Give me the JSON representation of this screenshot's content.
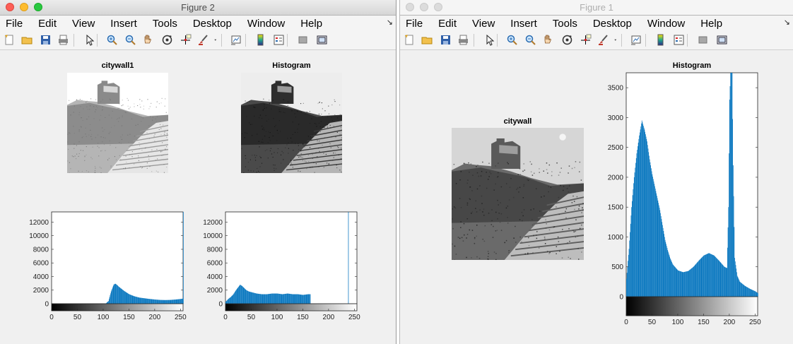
{
  "windows": [
    {
      "id": "figure2",
      "title": "Figure 2",
      "active": true,
      "menu": [
        "File",
        "Edit",
        "View",
        "Insert",
        "Tools",
        "Desktop",
        "Window",
        "Help"
      ],
      "images": [
        {
          "title": "citywall1",
          "style": "bright"
        },
        {
          "title": "Histogram",
          "style": "dark"
        }
      ],
      "histograms": [
        {
          "title": "",
          "style": "bright"
        },
        {
          "title": "",
          "style": "dark"
        }
      ]
    },
    {
      "id": "figure1",
      "title": "Figure 1",
      "active": false,
      "menu": [
        "File",
        "Edit",
        "View",
        "Insert",
        "Tools",
        "Desktop",
        "Window",
        "Help"
      ],
      "images": [
        {
          "title": "citywall",
          "style": "normal"
        }
      ],
      "histograms": [
        {
          "title": "Histogram",
          "style": "normal"
        }
      ]
    }
  ],
  "toolbar_icons": [
    "new-figure-icon",
    "open-file-icon",
    "save-icon",
    "print-icon",
    "pointer-icon",
    "zoom-in-icon",
    "zoom-out-icon",
    "pan-hand-icon",
    "rotate-3d-icon",
    "data-cursor-icon",
    "brush-icon",
    "brush-dropdown-icon",
    "link-plot-icon",
    "insert-colorbar-icon",
    "insert-legend-icon",
    "hide-plot-tools-icon",
    "show-plot-tools-icon"
  ],
  "chart_data": [
    {
      "type": "bar",
      "title": "",
      "figure": "Figure 2",
      "series_name": "citywall1",
      "xlim": [
        0,
        255
      ],
      "ylim": [
        0,
        13500
      ],
      "xticks": [
        0,
        50,
        100,
        150,
        200,
        250
      ],
      "yticks": [
        0,
        2000,
        4000,
        6000,
        8000,
        10000,
        12000
      ],
      "bins": [
        [
          100,
          0
        ],
        [
          105,
          60
        ],
        [
          110,
          400
        ],
        [
          115,
          1800
        ],
        [
          118,
          2400
        ],
        [
          120,
          2800
        ],
        [
          123,
          2950
        ],
        [
          126,
          2800
        ],
        [
          130,
          2500
        ],
        [
          135,
          2200
        ],
        [
          140,
          1900
        ],
        [
          145,
          1650
        ],
        [
          150,
          1400
        ],
        [
          160,
          1100
        ],
        [
          170,
          900
        ],
        [
          180,
          800
        ],
        [
          190,
          700
        ],
        [
          200,
          620
        ],
        [
          210,
          560
        ],
        [
          220,
          540
        ],
        [
          230,
          560
        ],
        [
          240,
          620
        ],
        [
          250,
          700
        ],
        [
          254,
          750
        ],
        [
          255,
          13500
        ]
      ],
      "colorbar": "grayscale 0-255",
      "color": "#0072bd"
    },
    {
      "type": "bar",
      "title": "",
      "figure": "Figure 2",
      "series_name": "Histogram",
      "xlim": [
        0,
        255
      ],
      "ylim": [
        0,
        13500
      ],
      "xticks": [
        0,
        50,
        100,
        150,
        200,
        250
      ],
      "yticks": [
        0,
        2000,
        4000,
        6000,
        8000,
        10000,
        12000
      ],
      "bins": [
        [
          0,
          300
        ],
        [
          5,
          700
        ],
        [
          10,
          1000
        ],
        [
          15,
          1400
        ],
        [
          20,
          2000
        ],
        [
          25,
          2500
        ],
        [
          28,
          2800
        ],
        [
          32,
          2600
        ],
        [
          36,
          2300
        ],
        [
          40,
          2000
        ],
        [
          45,
          1800
        ],
        [
          50,
          1700
        ],
        [
          60,
          1500
        ],
        [
          70,
          1400
        ],
        [
          80,
          1400
        ],
        [
          90,
          1500
        ],
        [
          100,
          1500
        ],
        [
          110,
          1400
        ],
        [
          120,
          1500
        ],
        [
          130,
          1400
        ],
        [
          140,
          1400
        ],
        [
          150,
          1300
        ],
        [
          160,
          1400
        ],
        [
          164,
          1400
        ],
        [
          165,
          0
        ],
        [
          237,
          0
        ],
        [
          238,
          13500
        ],
        [
          239,
          0
        ]
      ],
      "colorbar": "grayscale 0-255",
      "color": "#0072bd"
    },
    {
      "type": "bar",
      "title": "Histogram",
      "figure": "Figure 1",
      "series_name": "citywall",
      "xlim": [
        0,
        255
      ],
      "ylim": [
        0,
        3750
      ],
      "xticks": [
        0,
        50,
        100,
        150,
        200,
        250
      ],
      "yticks": [
        0,
        500,
        1000,
        1500,
        2000,
        2500,
        3000,
        3500
      ],
      "bins": [
        [
          0,
          300
        ],
        [
          5,
          800
        ],
        [
          10,
          1500
        ],
        [
          15,
          2000
        ],
        [
          20,
          2400
        ],
        [
          25,
          2700
        ],
        [
          30,
          2950
        ],
        [
          35,
          2800
        ],
        [
          40,
          2600
        ],
        [
          45,
          2300
        ],
        [
          50,
          2050
        ],
        [
          55,
          1850
        ],
        [
          60,
          1650
        ],
        [
          65,
          1450
        ],
        [
          70,
          1200
        ],
        [
          75,
          950
        ],
        [
          80,
          780
        ],
        [
          85,
          640
        ],
        [
          90,
          540
        ],
        [
          100,
          440
        ],
        [
          110,
          410
        ],
        [
          120,
          430
        ],
        [
          130,
          500
        ],
        [
          140,
          600
        ],
        [
          150,
          690
        ],
        [
          160,
          730
        ],
        [
          170,
          690
        ],
        [
          180,
          600
        ],
        [
          190,
          500
        ],
        [
          195,
          480
        ],
        [
          198,
          1500
        ],
        [
          200,
          3300
        ],
        [
          202,
          3750
        ],
        [
          205,
          3750
        ],
        [
          207,
          2200
        ],
        [
          210,
          650
        ],
        [
          215,
          350
        ],
        [
          220,
          250
        ],
        [
          230,
          180
        ],
        [
          240,
          130
        ],
        [
          250,
          90
        ],
        [
          255,
          60
        ]
      ],
      "colorbar": "grayscale 0-255",
      "color": "#0072bd"
    }
  ]
}
